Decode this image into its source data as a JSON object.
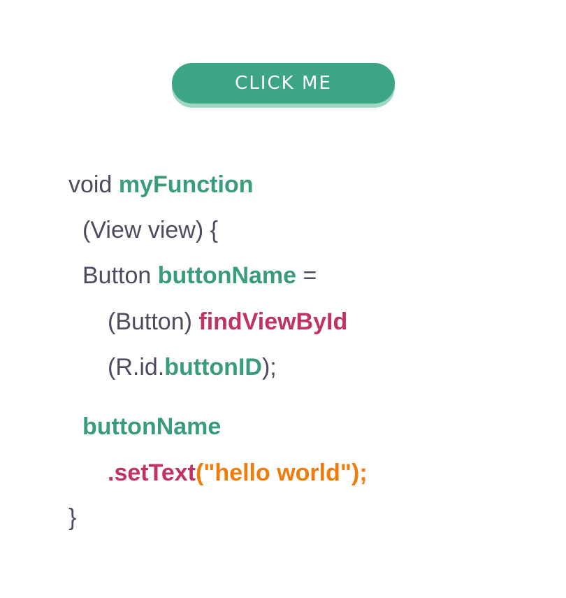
{
  "button": {
    "label": "CLICK ME"
  },
  "code": {
    "line1": {
      "plain": "void ",
      "function_name": "myFunction"
    },
    "line2": {
      "plain": "(View view) {"
    },
    "line3": {
      "plain": "Button ",
      "variable": "buttonName",
      "tail": " ="
    },
    "line4": {
      "plain": "(Button) ",
      "method": "findViewById"
    },
    "line5": {
      "prefix": "(R.id.",
      "id": "buttonID",
      "suffix": ");"
    },
    "line6": {
      "variable": "buttonName"
    },
    "line7": {
      "method": ".setText",
      "args": "(\"hello world\");"
    },
    "line8": {
      "plain": "}"
    }
  },
  "colors": {
    "button_bg": "#3ba585",
    "button_shadow": "#9fd6c4",
    "text": "#4e4b5e",
    "green": "#3a9c7e",
    "magenta": "#c0325f",
    "orange": "#f07d0b"
  }
}
